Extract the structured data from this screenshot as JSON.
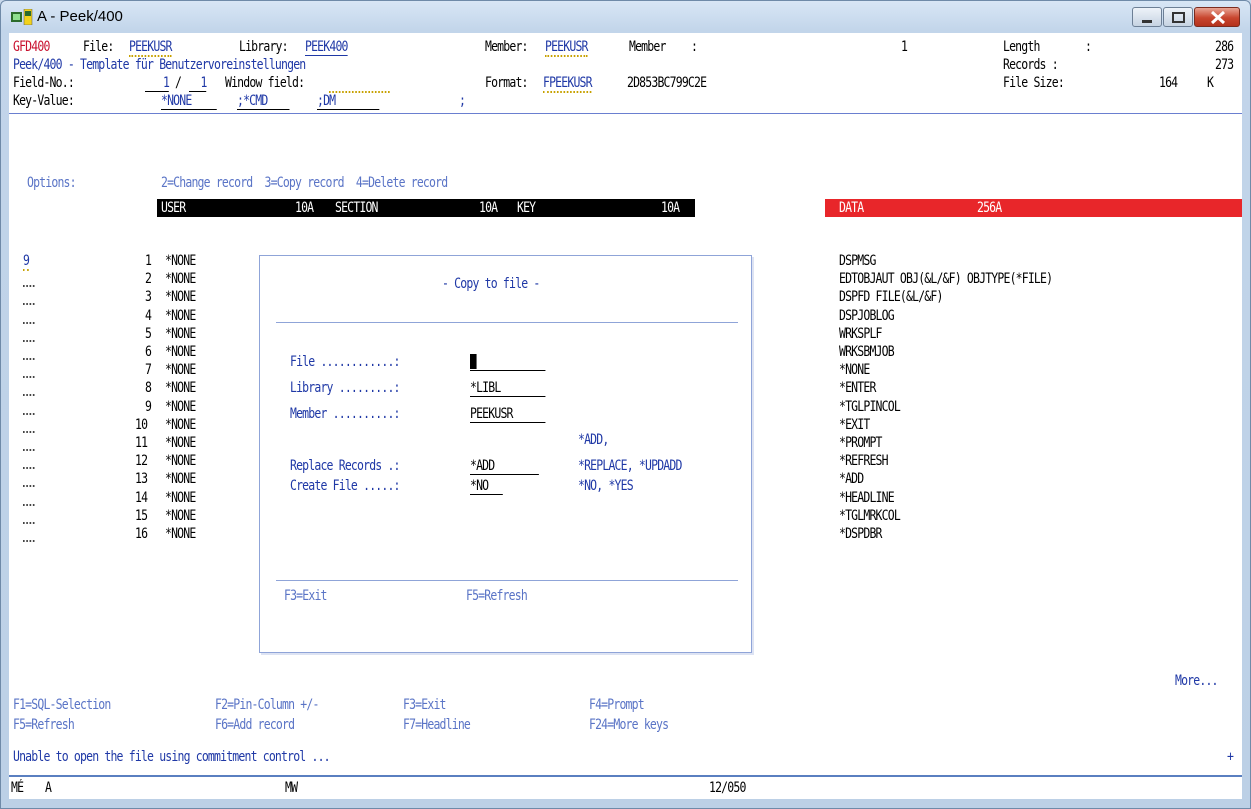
{
  "window": {
    "title": "A - Peek/400"
  },
  "header": {
    "program": "GFD400",
    "file_label": "File:",
    "file_value": "PEEKUSR",
    "library_label": "Library:",
    "library_value": "PEEK400",
    "member_label": "Member:",
    "member_value": "PEEKUSR",
    "member2_label": "Member",
    "member2_colon": ":",
    "member2_value": "1",
    "length_label": "Length",
    "length_colon": ":",
    "length_value": "286",
    "subtitle": "Peek/400 - Template für Benutzervoreinstellungen",
    "records_label": "Records :",
    "records_value": "273",
    "fieldno_label": "Field-No.:",
    "fieldno_a": "1",
    "fieldno_sep": "/",
    "fieldno_b": "1",
    "window_field_label": "Window field:",
    "format_label": "Format:",
    "format_value": "FPEEKUSR",
    "format_id": "2D853BC799C2E",
    "filesize_label": "File Size:",
    "filesize_value": "164",
    "filesize_unit": "K",
    "keyvalue_label": "Key-Value:",
    "key1": "*NONE",
    "key2": ";*CMD",
    "key3": ";DM",
    "key4": ";",
    "options_label": "Options:",
    "options_text": "2=Change record  3=Copy record  4=Delete record"
  },
  "columns": [
    {
      "name": "USER",
      "type": "10A"
    },
    {
      "name": "SECTION",
      "type": "10A"
    },
    {
      "name": "KEY",
      "type": "10A"
    },
    {
      "name": "DATA",
      "type": "256A"
    }
  ],
  "rows": [
    {
      "opt": "9",
      "num": "1",
      "user": "*NONE",
      "data": "DSPMSG"
    },
    {
      "opt": "",
      "num": "2",
      "user": "*NONE",
      "data": "EDTOBJAUT OBJ(&L/&F) OBJTYPE(*FILE)"
    },
    {
      "opt": "",
      "num": "3",
      "user": "*NONE",
      "data": "DSPFD FILE(&L/&F)"
    },
    {
      "opt": "",
      "num": "4",
      "user": "*NONE",
      "data": "DSPJOBLOG"
    },
    {
      "opt": "",
      "num": "5",
      "user": "*NONE",
      "data": "WRKSPLF"
    },
    {
      "opt": "",
      "num": "6",
      "user": "*NONE",
      "data": "WRKSBMJOB"
    },
    {
      "opt": "",
      "num": "7",
      "user": "*NONE",
      "data": "*NONE"
    },
    {
      "opt": "",
      "num": "8",
      "user": "*NONE",
      "data": "*ENTER"
    },
    {
      "opt": "",
      "num": "9",
      "user": "*NONE",
      "data": "*TGLPINCOL"
    },
    {
      "opt": "",
      "num": "10",
      "user": "*NONE",
      "data": "*EXIT"
    },
    {
      "opt": "",
      "num": "11",
      "user": "*NONE",
      "data": "*PROMPT"
    },
    {
      "opt": "",
      "num": "12",
      "user": "*NONE",
      "data": "*REFRESH"
    },
    {
      "opt": "",
      "num": "13",
      "user": "*NONE",
      "data": "*ADD"
    },
    {
      "opt": "",
      "num": "14",
      "user": "*NONE",
      "data": "*HEADLINE"
    },
    {
      "opt": "",
      "num": "15",
      "user": "*NONE",
      "data": "*TGLMRKCOL"
    },
    {
      "opt": "",
      "num": "16",
      "user": "*NONE",
      "data": "*DSPDBR"
    }
  ],
  "popup": {
    "title": "- Copy to file -",
    "file_label": "File ............:",
    "file_value": "",
    "library_label": "Library .........:",
    "library_value": "*LIBL",
    "member_label": "Member ..........:",
    "member_value": "PEEKUSR",
    "replace_hint1": "*ADD,",
    "replace_label": "Replace Records .:",
    "replace_value": "*ADD",
    "replace_hint2": "*REPLACE, *UPDADD",
    "create_label": "Create File .....:",
    "create_value": "*NO",
    "create_hint": "*NO, *YES",
    "f3": "F3=Exit",
    "f5": "F5=Refresh"
  },
  "more": "More...",
  "fkeys": {
    "f1": "F1=SQL-Selection",
    "f2": "F2=Pin-Column +/-",
    "f3": "F3=Exit",
    "f4": "F4=Prompt",
    "f5": "F5=Refresh",
    "f6": "F6=Add record",
    "f7": "F7=Headline",
    "f24": "F24=More keys"
  },
  "message": "Unable to open the file using commitment control ...",
  "message_plus": "+",
  "statusbar": {
    "left": "MÉ",
    "a": "A",
    "mw": "MW",
    "pos": "12/050"
  }
}
